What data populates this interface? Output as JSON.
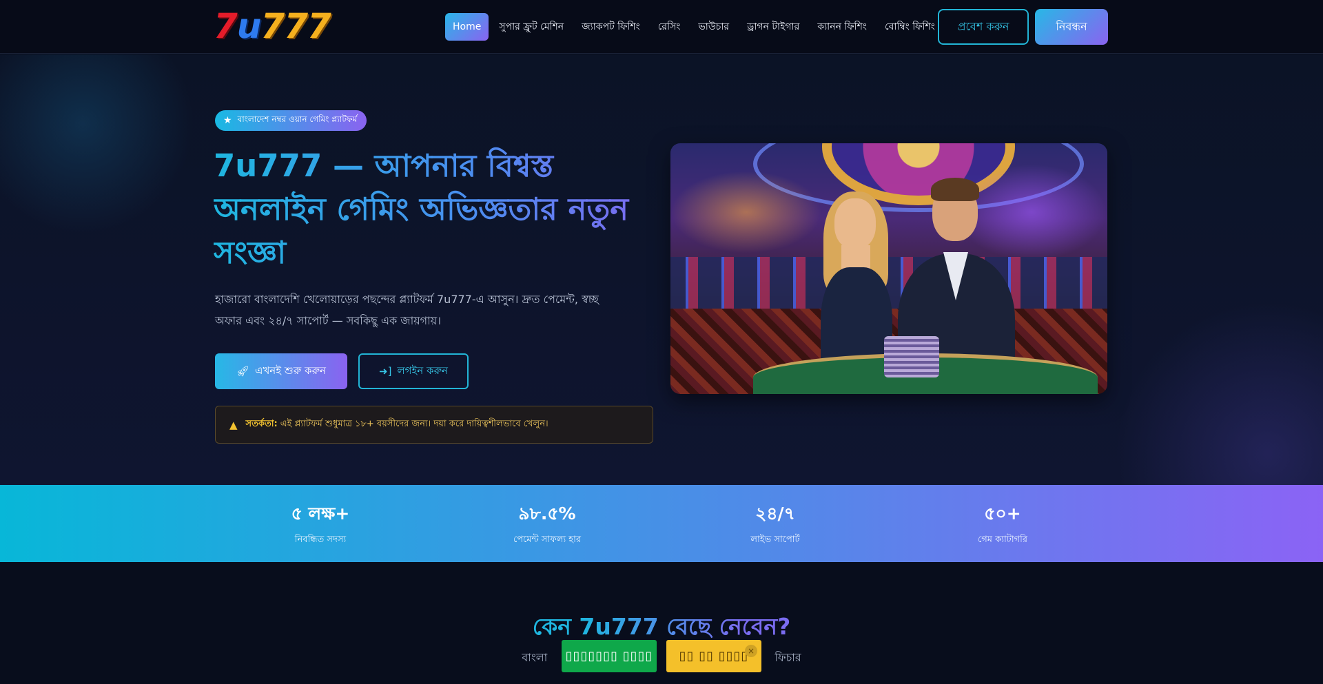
{
  "header": {
    "logo": {
      "seven": "7",
      "u": "u",
      "nums": "777"
    },
    "nav": [
      {
        "label": "Home",
        "active": true
      },
      {
        "label": "সুপার ফ্রুট মেশিন"
      },
      {
        "label": "জ্যাকপট ফিশিং"
      },
      {
        "label": "রেসিং"
      },
      {
        "label": "ভাউচার"
      },
      {
        "label": "ড্রাগন টাইগার"
      },
      {
        "label": "ক্যানন ফিশিং"
      },
      {
        "label": "বোম্বিং ফিশিং"
      }
    ],
    "login_label": "প্রবেশ করুন",
    "register_label": "নিবন্ধন"
  },
  "hero": {
    "badge_icon": "star-icon",
    "badge_text": "বাংলাদেশ নম্বর ওয়ান গেমিং প্ল্যাটফর্ম",
    "title": "7u777 — আপনার বিশ্বস্ত অনলাইন গেমিং অভিজ্ঞতার নতুন সংজ্ঞা",
    "subtitle": "হাজারো বাংলাদেশি খেলোয়াড়ের পছন্দের প্ল্যাটফর্ম 7u777-এ আসুন। দ্রুত পেমেন্ট, স্বচ্ছ অফার এবং ২৪/৭ সাপোর্ট — সবকিছু এক জায়গায়।",
    "start_button": "এখনই শুরু করুন",
    "login_button": "লগইন করুন",
    "warning_label": "সতর্কতা:",
    "warning_text": "এই প্ল্যাটফর্ম শুধুমাত্র ১৮+ বয়সীদের জন্য। দয়া করে দায়িত্বশীলভাবে খেলুন।"
  },
  "stats": [
    {
      "value": "৫ লক্ষ+",
      "label": "নিবন্ধিত সদস্য"
    },
    {
      "value": "৯৮.৫%",
      "label": "পেমেন্ট সাফল্য হার"
    },
    {
      "value": "২৪/৭",
      "label": "লাইভ সাপোর্ট"
    },
    {
      "value": "৫০+",
      "label": "গেম ক্যাটাগরি"
    }
  ],
  "why": {
    "title": "কেন 7u777 বেছে নেবেন?",
    "subtitle_left": "বাংলা",
    "subtitle_right": "ফিচার"
  },
  "floating": {
    "button_a": "▯▯▯▯▯▯▯ ▯▯▯▯",
    "button_b": "▯▯ ▯▯ ▯▯▯▯",
    "close": "×"
  },
  "colors": {
    "accent_cyan": "#22b5d6",
    "accent_purple": "#8a63f0",
    "warning": "#f2c230",
    "float_green": "#0fa84a",
    "float_yellow": "#f4c02a"
  }
}
